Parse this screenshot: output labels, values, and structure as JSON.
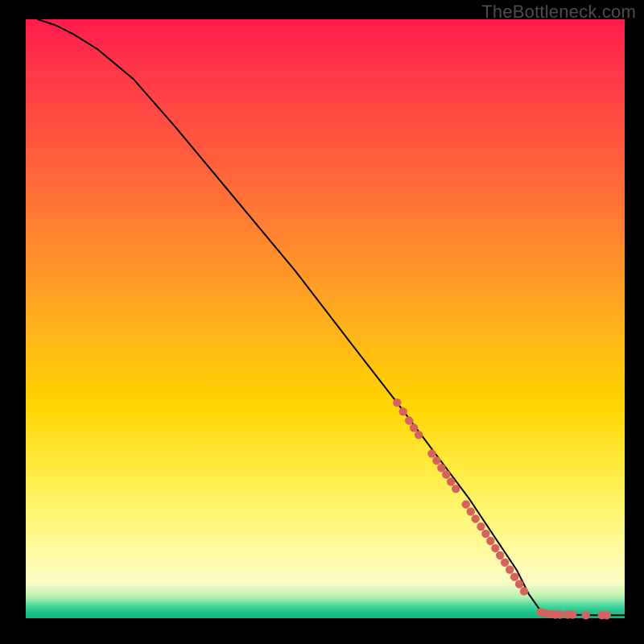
{
  "watermark": "TheBottleneck.com",
  "chart_data": {
    "type": "line",
    "title": "",
    "xlabel": "",
    "ylabel": "",
    "xlim": [
      0,
      100
    ],
    "ylim": [
      0,
      100
    ],
    "grid": false,
    "legend": false,
    "curve": {
      "x": [
        2,
        5,
        8,
        12,
        18,
        25,
        35,
        45,
        55,
        62,
        68,
        74,
        78,
        82,
        84,
        86,
        90,
        95,
        100
      ],
      "y": [
        100,
        99,
        97.5,
        95,
        90,
        82,
        70,
        58,
        45,
        36,
        28,
        20,
        14,
        8,
        4,
        1.2,
        0.6,
        0.5,
        0.5
      ]
    },
    "dots": {
      "color": "#d6625f",
      "r": 5.2,
      "points": [
        {
          "x": 62.0,
          "y": 36.0
        },
        {
          "x": 63.0,
          "y": 34.5
        },
        {
          "x": 64.0,
          "y": 33.0
        },
        {
          "x": 64.8,
          "y": 31.8
        },
        {
          "x": 65.6,
          "y": 30.6
        },
        {
          "x": 67.8,
          "y": 27.5
        },
        {
          "x": 68.6,
          "y": 26.3
        },
        {
          "x": 69.4,
          "y": 25.1
        },
        {
          "x": 70.2,
          "y": 24.0
        },
        {
          "x": 71.0,
          "y": 22.8
        },
        {
          "x": 71.8,
          "y": 21.6
        },
        {
          "x": 73.5,
          "y": 19.0
        },
        {
          "x": 74.3,
          "y": 17.8
        },
        {
          "x": 75.1,
          "y": 16.6
        },
        {
          "x": 76.0,
          "y": 15.3
        },
        {
          "x": 76.8,
          "y": 14.1
        },
        {
          "x": 77.6,
          "y": 12.9
        },
        {
          "x": 78.4,
          "y": 11.7
        },
        {
          "x": 79.2,
          "y": 10.5
        },
        {
          "x": 80.0,
          "y": 9.3
        },
        {
          "x": 80.8,
          "y": 8.1
        },
        {
          "x": 81.6,
          "y": 6.9
        },
        {
          "x": 82.4,
          "y": 5.7
        },
        {
          "x": 83.2,
          "y": 4.5
        },
        {
          "x": 86.0,
          "y": 1.0
        },
        {
          "x": 86.8,
          "y": 0.8
        },
        {
          "x": 87.6,
          "y": 0.7
        },
        {
          "x": 88.4,
          "y": 0.6
        },
        {
          "x": 89.2,
          "y": 0.6
        },
        {
          "x": 90.5,
          "y": 0.6
        },
        {
          "x": 91.3,
          "y": 0.6
        },
        {
          "x": 93.5,
          "y": 0.5
        },
        {
          "x": 96.2,
          "y": 0.5
        },
        {
          "x": 97.0,
          "y": 0.5
        }
      ]
    }
  }
}
